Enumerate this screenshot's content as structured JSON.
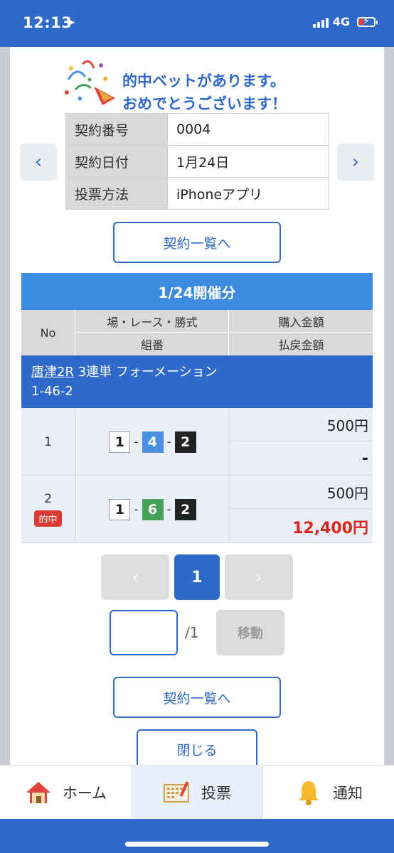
{
  "status_bar": {
    "time": "12:13",
    "network": "4G"
  },
  "congrats": {
    "line1": "的中ベットがあります。",
    "line2": "おめでとうございます！"
  },
  "contract": {
    "rows": [
      {
        "key": "契約番号",
        "value": "0004"
      },
      {
        "key": "契約日付",
        "value": "1月24日"
      },
      {
        "key": "投票方法",
        "value": "iPhoneアプリ"
      }
    ]
  },
  "buttons": {
    "contract_list": "契約一覧へ",
    "close": "閉じる",
    "move": "移動"
  },
  "race_table": {
    "title": "1/24開催分",
    "headers": {
      "no": "No",
      "race": "場・レース・勝式",
      "combo": "組番",
      "purchase": "購入金額",
      "payout": "払戻金額"
    },
    "bet": {
      "venue": "唐津2R",
      "type": "3連単 フォーメーション",
      "formation": "1-46-2"
    },
    "rows": [
      {
        "no": "1",
        "combo": [
          "1",
          "4",
          "2"
        ],
        "purchase": "500円",
        "payout": "-",
        "hit": ""
      },
      {
        "no": "2",
        "combo": [
          "1",
          "6",
          "2"
        ],
        "purchase": "500円",
        "payout": "12,400円",
        "hit": "的中"
      }
    ]
  },
  "pagination": {
    "prev": "‹",
    "current": "1",
    "next": "›",
    "input_value": "",
    "total": "/1"
  },
  "tabbar": {
    "items": [
      {
        "label": "ホーム",
        "icon": "home-icon"
      },
      {
        "label": "投票",
        "icon": "ticket-icon"
      },
      {
        "label": "通知",
        "icon": "bell-icon"
      }
    ]
  },
  "colors": {
    "primary": "#2f69c9",
    "header_blue": "#3d8be0",
    "win_red": "#d9251c"
  }
}
